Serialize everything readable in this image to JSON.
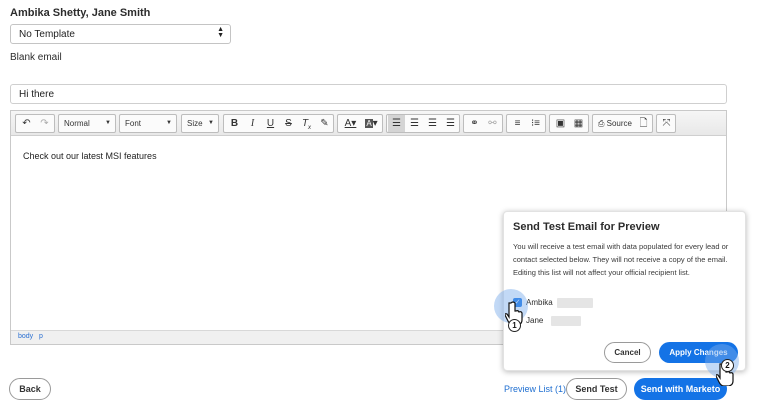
{
  "header": {
    "recipients": "Ambika Shetty, Jane Smith",
    "template_value": "No Template",
    "template_description": "Blank email",
    "subject_value": "Hi there"
  },
  "toolbar": {
    "format_value": "Normal",
    "font_value": "Font",
    "size_value": "Size",
    "source_label": "Source",
    "icons": [
      "undo-icon",
      "redo-icon",
      "bold-icon",
      "italic-icon",
      "underline-icon",
      "strikethrough-icon",
      "clear-format-icon",
      "paint-icon",
      "text-color-icon",
      "background-color-icon",
      "align-left-icon",
      "align-center-icon",
      "align-right-icon",
      "align-justify-icon",
      "link-icon",
      "unlink-icon",
      "numbered-list-icon",
      "bulleted-list-icon",
      "image-icon",
      "table-icon",
      "source-icon",
      "preview-icon",
      "maximize-icon"
    ]
  },
  "editor": {
    "body_text": "Check out our latest MSI features",
    "path": [
      "body",
      "p"
    ]
  },
  "footer": {
    "back_label": "Back",
    "preview_link": "Preview List (1)",
    "send_test_label": "Send Test",
    "send_marketo_label": "Send with Marketo"
  },
  "popover": {
    "title": "Send Test Email for Preview",
    "description": "You will receive a test email with data populated for every lead or contact selected below. They will not receive a copy of the email. Editing this list will not affect your official recipient list.",
    "recipients": [
      {
        "name": "Ambika",
        "checked": true
      },
      {
        "name": "Jane",
        "checked": false
      }
    ],
    "cancel_label": "Cancel",
    "apply_label": "Apply Changes"
  },
  "annotations": {
    "step1": "1",
    "step2": "2"
  },
  "colors": {
    "accent": "#1473e6",
    "link": "#1f6fd1"
  }
}
